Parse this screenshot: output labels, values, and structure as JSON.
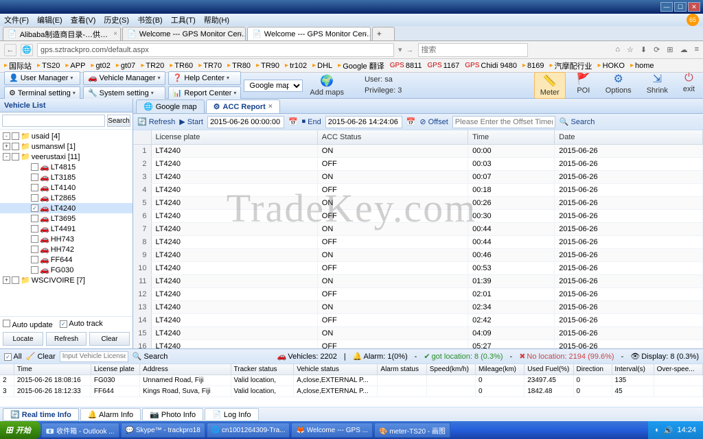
{
  "window": {
    "badge": "65"
  },
  "menus": [
    "文件(F)",
    "编辑(E)",
    "查看(V)",
    "历史(S)",
    "书签(B)",
    "工具(T)",
    "帮助(H)"
  ],
  "browser_tabs": [
    {
      "title": "Alibaba制造商目录-…供…",
      "active": false
    },
    {
      "title": "Welcome --- GPS Monitor Cen…",
      "active": false
    },
    {
      "title": "Welcome --- GPS Monitor Cen…",
      "active": true
    }
  ],
  "url": "gps.sztrackpro.com/default.aspx",
  "search_placeholder": "搜索",
  "bookmarks": [
    "国际站",
    "TS20",
    "APP",
    "gt02",
    "gt07",
    "TR20",
    "TR60",
    "TR70",
    "TR80",
    "TR90",
    "tr102",
    "DHL",
    "Google 翻译",
    "8811",
    "1167",
    "Chidi 9480",
    "8169",
    "汽摩配行业",
    "HOKO",
    "home"
  ],
  "app_toolbar": {
    "user_manager": "User Manager",
    "vehicle_manager": "Vehicle Manager",
    "terminal_setting": "Terminal setting",
    "system_setting": "System setting",
    "help_center": "Help Center",
    "report_center": "Report Center",
    "map_select": "Google map",
    "add_maps": "Add maps",
    "user_label": "User: sa",
    "priv_label": "Privilege: 3",
    "right": {
      "meter": "Meter",
      "poi": "POI",
      "options": "Options",
      "shrink": "Shrink",
      "exit": "exit"
    }
  },
  "sidebar": {
    "title": "Vehicle List",
    "search": "Search",
    "auto_update": "Auto update",
    "auto_track": "Auto track",
    "locate": "Locate",
    "refresh": "Refresh",
    "clear": "Clear",
    "tree": [
      {
        "d": 1,
        "t": "-",
        "cb": "",
        "ic": "folder",
        "label": "usaid [4]"
      },
      {
        "d": 1,
        "t": "+",
        "cb": "",
        "ic": "folder",
        "label": "usmanswl [1]"
      },
      {
        "d": 1,
        "t": "-",
        "cb": "",
        "ic": "folder",
        "label": "veerustaxi [11]"
      },
      {
        "d": 3,
        "t": "",
        "cb": "",
        "ic": "car",
        "label": "LT4815"
      },
      {
        "d": 3,
        "t": "",
        "cb": "",
        "ic": "car",
        "label": "LT3185"
      },
      {
        "d": 3,
        "t": "",
        "cb": "",
        "ic": "car",
        "label": "LT4140"
      },
      {
        "d": 3,
        "t": "",
        "cb": "",
        "ic": "car",
        "label": "LT2865"
      },
      {
        "d": 3,
        "t": "",
        "cb": "✓",
        "ic": "car",
        "label": "LT4240",
        "sel": true
      },
      {
        "d": 3,
        "t": "",
        "cb": "",
        "ic": "car",
        "label": "LT3695"
      },
      {
        "d": 3,
        "t": "",
        "cb": "",
        "ic": "car",
        "label": "LT4491"
      },
      {
        "d": 3,
        "t": "",
        "cb": "",
        "ic": "car",
        "label": "HH743"
      },
      {
        "d": 3,
        "t": "",
        "cb": "",
        "ic": "car",
        "label": "HH742"
      },
      {
        "d": 3,
        "t": "",
        "cb": "",
        "ic": "car",
        "label": "FF644"
      },
      {
        "d": 3,
        "t": "",
        "cb": "",
        "ic": "car",
        "label": "FG030"
      },
      {
        "d": 1,
        "t": "+",
        "cb": "",
        "ic": "folder",
        "label": "WSCIVOIRE [7]"
      }
    ]
  },
  "center": {
    "tabs": [
      {
        "label": "Google map",
        "active": false
      },
      {
        "label": "ACC Report",
        "active": true
      }
    ],
    "filter": {
      "refresh": "Refresh",
      "start": "Start",
      "start_val": "2015-06-26 00:00:00",
      "end": "End",
      "end_val": "2015-06-26 14:24:06",
      "offset": "Offset",
      "offset_ph": "Please Enter the Offset Time(S) I",
      "search": "Search"
    },
    "columns": [
      "License plate",
      "ACC Status",
      "Time",
      "Date"
    ],
    "rows": [
      [
        "LT4240",
        "ON",
        "00:00",
        "2015-06-26"
      ],
      [
        "LT4240",
        "OFF",
        "00:03",
        "2015-06-26"
      ],
      [
        "LT4240",
        "ON",
        "00:07",
        "2015-06-26"
      ],
      [
        "LT4240",
        "OFF",
        "00:18",
        "2015-06-26"
      ],
      [
        "LT4240",
        "ON",
        "00:26",
        "2015-06-26"
      ],
      [
        "LT4240",
        "OFF",
        "00:30",
        "2015-06-26"
      ],
      [
        "LT4240",
        "ON",
        "00:44",
        "2015-06-26"
      ],
      [
        "LT4240",
        "OFF",
        "00:44",
        "2015-06-26"
      ],
      [
        "LT4240",
        "ON",
        "00:46",
        "2015-06-26"
      ],
      [
        "LT4240",
        "OFF",
        "00:53",
        "2015-06-26"
      ],
      [
        "LT4240",
        "ON",
        "01:39",
        "2015-06-26"
      ],
      [
        "LT4240",
        "OFF",
        "02:01",
        "2015-06-26"
      ],
      [
        "LT4240",
        "ON",
        "02:34",
        "2015-06-26"
      ],
      [
        "LT4240",
        "OFF",
        "02:42",
        "2015-06-26"
      ],
      [
        "LT4240",
        "ON",
        "04:09",
        "2015-06-26"
      ],
      [
        "LT4240",
        "OFF",
        "05:27",
        "2015-06-26"
      ]
    ]
  },
  "bottom": {
    "all": "All",
    "clear": "Clear",
    "input_ph": "Input Vehicle License",
    "search": "Search",
    "status": {
      "vehicles": "Vehicles: 2202",
      "alarm": "Alarm: 1(0%)",
      "got": "got location: 8 (0.3%)",
      "nolocation": "No location: 2194 (99.6%)",
      "display": "Display: 8 (0.3%)"
    },
    "columns": [
      "",
      "Time",
      "License plate",
      "Address",
      "Tracker status",
      "Vehicle status",
      "Alarm status",
      "Speed(km/h)",
      "Mileage(km)",
      "Used Fuel(%)",
      "Direction",
      "Interval(s)",
      "Over-spee..."
    ],
    "rows": [
      [
        "2",
        "2015-06-26 18:08:16",
        "FG030",
        "Unnamed Road, Fiji",
        "Valid location,",
        "A,close,EXTERNAL P...",
        "",
        "",
        "0",
        "23497.45",
        "0",
        "135",
        ""
      ],
      [
        "3",
        "2015-06-26 18:12:33",
        "FF644",
        "Kings Road, Suva, Fiji",
        "Valid location,",
        "A,close,EXTERNAL P...",
        "",
        "",
        "0",
        "1842.48",
        "0",
        "45",
        ""
      ]
    ],
    "tabs": [
      "Real time Info",
      "Alarm Info",
      "Photo Info",
      "Log Info"
    ]
  },
  "taskbar": {
    "start": "开始",
    "items": [
      "收件箱 - Outlook ...",
      "Skype™ - trackpro18",
      "cn1001264309-Tra...",
      "Welcome --- GPS ...",
      "meter-TS20 - 画图"
    ],
    "time": "14:24"
  },
  "watermark": "TradeKey.com"
}
